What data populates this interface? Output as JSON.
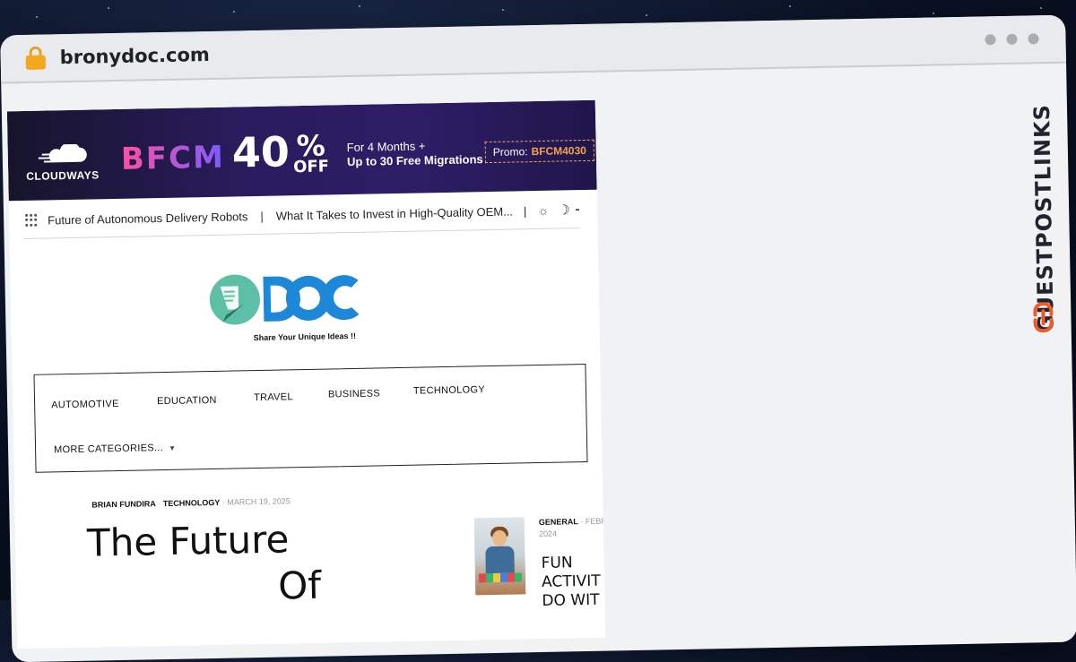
{
  "browser": {
    "url": "bronydoc.com"
  },
  "watermark": {
    "text": "GUESTPOSTLINKS"
  },
  "ad_banner": {
    "brand": "CLOUDWAYS",
    "campaign": "BFCM",
    "discount": "40",
    "percent": "%",
    "off": "OFF",
    "offer_line1": "For 4 Months +",
    "offer_line2": "Up to 30 Free Migrations",
    "promo_label": "Promo:",
    "promo_code": "BFCM4030"
  },
  "ticker": {
    "item1": "Future of Autonomous Delivery Robots",
    "separator": "|",
    "item2": "What It Takes to Invest in High-Quality OEM..."
  },
  "site": {
    "tagline": "Share Your Unique Ideas !!"
  },
  "nav": {
    "items": [
      "AUTOMOTIVE",
      "EDUCATION",
      "TRAVEL",
      "BUSINESS",
      "TECHNOLOGY"
    ],
    "more": "MORE CATEGORIES...",
    "more_caret": "▼"
  },
  "featured": {
    "author": "BRIAN FUNDIRA",
    "dot": "·",
    "category": "TECHNOLOGY",
    "date": "MARCH 19, 2025",
    "title_line1": "The Future",
    "title_line2": "Of"
  },
  "sidebar_post": {
    "category": "GENERAL",
    "date_part1": "FEBR",
    "date_part2": "2024",
    "title_line1": "FUN",
    "title_line2": "ACTIVIT",
    "title_line3": "DO WIT"
  },
  "colors": {
    "accent_orange": "#f3a71f",
    "doc_blue": "#1e88d8",
    "doc_teal": "#5cbfa6",
    "banner_purple": "#2a1c5e"
  }
}
